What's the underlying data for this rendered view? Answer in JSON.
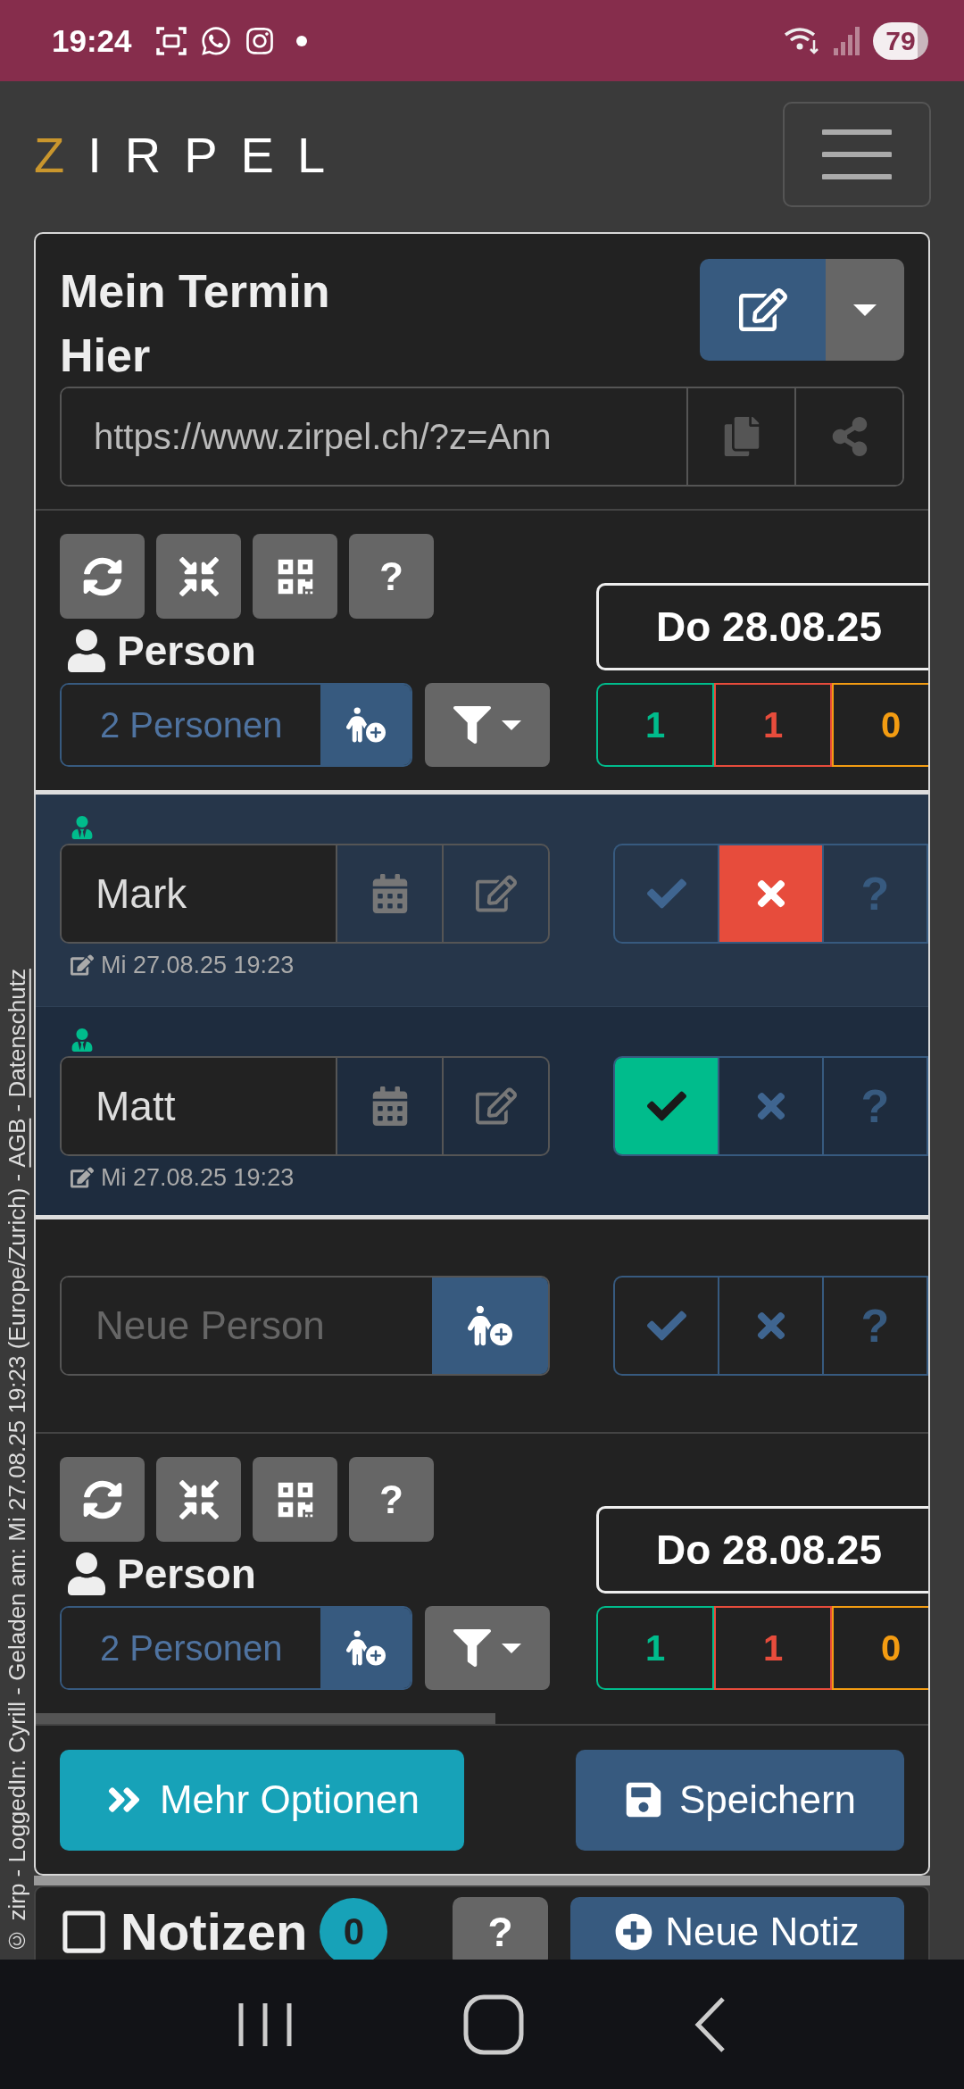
{
  "status_bar": {
    "time": "19:24",
    "battery": "79"
  },
  "header": {
    "logo": "ZIRPEL"
  },
  "event": {
    "title": "Mein Termin Hier",
    "url": "https://www.zirpel.ch/?z=Ann"
  },
  "summary_top": {
    "tools": [
      {
        "kind": "refresh"
      },
      {
        "kind": "collapse"
      },
      {
        "kind": "qr"
      },
      {
        "kind": "help",
        "label": "?"
      }
    ],
    "label": "Person",
    "count": "2 Personen",
    "date": "Do 28.08.25",
    "tallies": [
      {
        "value": "1",
        "color": "#00bc8c"
      },
      {
        "value": "1",
        "color": "#e74c3c"
      },
      {
        "value": "0",
        "color": "#f39c12"
      }
    ]
  },
  "persons": [
    {
      "name": "Mark",
      "edited": "Mi 27.08.25 19:23",
      "answers": [
        {
          "kind": "yes",
          "selected": false
        },
        {
          "kind": "no",
          "selected": true
        },
        {
          "kind": "maybe",
          "label": "?",
          "selected": false
        }
      ]
    },
    {
      "name": "Matt",
      "edited": "Mi 27.08.25 19:23",
      "answers": [
        {
          "kind": "yes",
          "selected": true
        },
        {
          "kind": "no",
          "selected": false
        },
        {
          "kind": "maybe",
          "label": "?",
          "selected": false
        }
      ]
    }
  ],
  "new_person": {
    "placeholder": "Neue Person",
    "answers": [
      {
        "kind": "yes",
        "selected": false
      },
      {
        "kind": "no",
        "selected": false
      },
      {
        "kind": "maybe",
        "label": "?",
        "selected": false
      }
    ]
  },
  "summary_bottom": {
    "tools": [
      {
        "kind": "refresh"
      },
      {
        "kind": "collapse"
      },
      {
        "kind": "qr"
      },
      {
        "kind": "help",
        "label": "?"
      }
    ],
    "label": "Person",
    "count": "2 Personen",
    "date": "Do 28.08.25",
    "tallies": [
      {
        "value": "1",
        "color": "#00bc8c"
      },
      {
        "value": "1",
        "color": "#e74c3c"
      },
      {
        "value": "0",
        "color": "#f39c12"
      }
    ]
  },
  "actions": [
    {
      "kind": "more",
      "label": "Mehr Optionen"
    },
    {
      "kind": "save",
      "label": "Speichern"
    }
  ],
  "notes": {
    "title": "Notizen",
    "count": "0",
    "help": "?",
    "add": "Neue Notiz"
  },
  "footer": [
    {
      "kind": "text",
      "text": "© zirp - LoggedIn: Cyrill - Geladen am: Mi 27.08.25 19:23 (Europe/Zurich) - "
    },
    {
      "kind": "link",
      "text": "AGB"
    },
    {
      "kind": "text",
      "text": " - "
    },
    {
      "kind": "link",
      "text": "Datenschutz"
    }
  ]
}
